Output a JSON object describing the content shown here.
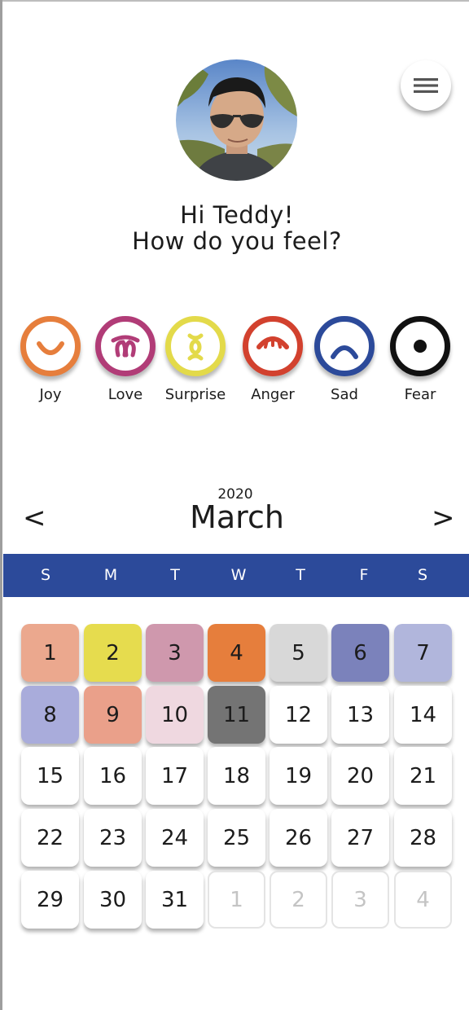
{
  "user": {
    "avatar_icon": "user-photo",
    "greeting_line1": "Hi Teddy!",
    "greeting_line2": "How do you feel?"
  },
  "menu": {
    "icon": "hamburger-menu-icon"
  },
  "emotions": [
    {
      "label": "Joy",
      "color": "#e67e3c",
      "icon": "smile-icon"
    },
    {
      "label": "Love",
      "color": "#b13c77",
      "icon": "love-icon"
    },
    {
      "label": "Surprise",
      "color": "#e3da4a",
      "icon": "surprise-icon"
    },
    {
      "label": "Anger",
      "color": "#d2412e",
      "icon": "anger-icon"
    },
    {
      "label": "Sad",
      "color": "#2c4a9a",
      "icon": "frown-icon"
    },
    {
      "label": "Fear",
      "color": "#111111",
      "icon": "fear-icon"
    }
  ],
  "calendar": {
    "year": "2020",
    "month": "March",
    "prev_label": "<",
    "next_label": ">",
    "header_color": "#2c4a9a",
    "weekdays": [
      "S",
      "M",
      "T",
      "W",
      "T",
      "F",
      "S"
    ],
    "days": [
      {
        "label": "1",
        "color": "#eba88e"
      },
      {
        "label": "2",
        "color": "#e6dc4e"
      },
      {
        "label": "3",
        "color": "#cf98ad"
      },
      {
        "label": "4",
        "color": "#e67e3c"
      },
      {
        "label": "5",
        "color": "#d8d8d8"
      },
      {
        "label": "6",
        "color": "#7b82bb"
      },
      {
        "label": "7",
        "color": "#b1b6dc"
      },
      {
        "label": "8",
        "color": "#a9acdb"
      },
      {
        "label": "9",
        "color": "#eaa08a"
      },
      {
        "label": "10",
        "color": "#efd8e0"
      },
      {
        "label": "11",
        "color": "#747474"
      },
      {
        "label": "12",
        "color": "#ffffff"
      },
      {
        "label": "13",
        "color": "#ffffff"
      },
      {
        "label": "14",
        "color": "#ffffff"
      },
      {
        "label": "15",
        "color": "#ffffff"
      },
      {
        "label": "16",
        "color": "#ffffff"
      },
      {
        "label": "17",
        "color": "#ffffff"
      },
      {
        "label": "18",
        "color": "#ffffff"
      },
      {
        "label": "19",
        "color": "#ffffff"
      },
      {
        "label": "20",
        "color": "#ffffff"
      },
      {
        "label": "21",
        "color": "#ffffff"
      },
      {
        "label": "22",
        "color": "#ffffff"
      },
      {
        "label": "23",
        "color": "#ffffff"
      },
      {
        "label": "24",
        "color": "#ffffff"
      },
      {
        "label": "25",
        "color": "#ffffff"
      },
      {
        "label": "26",
        "color": "#ffffff"
      },
      {
        "label": "27",
        "color": "#ffffff"
      },
      {
        "label": "28",
        "color": "#ffffff"
      },
      {
        "label": "29",
        "color": "#ffffff"
      },
      {
        "label": "30",
        "color": "#ffffff"
      },
      {
        "label": "31",
        "color": "#ffffff"
      },
      {
        "label": "1",
        "color": "#ffffff",
        "other_month": true
      },
      {
        "label": "2",
        "color": "#ffffff",
        "other_month": true
      },
      {
        "label": "3",
        "color": "#ffffff",
        "other_month": true
      },
      {
        "label": "4",
        "color": "#ffffff",
        "other_month": true
      }
    ]
  }
}
